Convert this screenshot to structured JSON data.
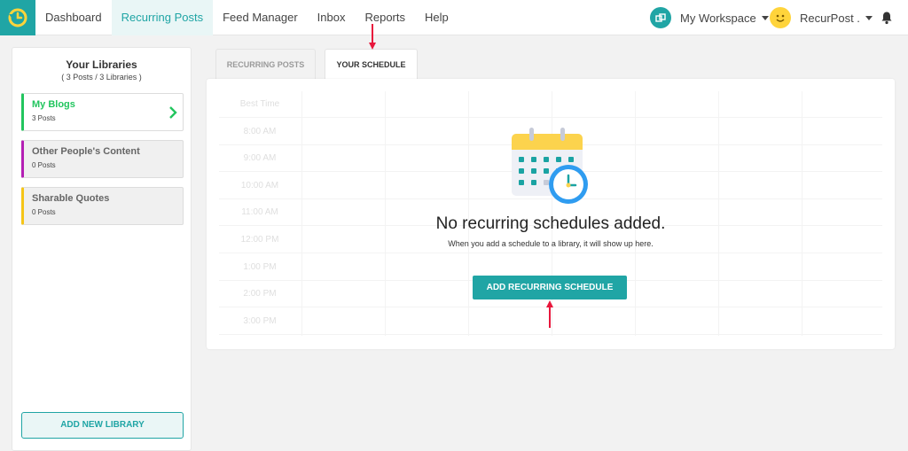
{
  "nav": {
    "items": [
      {
        "label": "Dashboard"
      },
      {
        "label": "Recurring Posts"
      },
      {
        "label": "Feed Manager"
      },
      {
        "label": "Inbox"
      },
      {
        "label": "Reports"
      },
      {
        "label": "Help"
      }
    ],
    "active": "Recurring Posts",
    "workspace": "My Workspace",
    "user": "RecurPost ."
  },
  "sidebar": {
    "title": "Your Libraries",
    "subtitle": "( 3 Posts / 3 Libraries )",
    "libraries": [
      {
        "name": "My Blogs",
        "count": "3 Posts",
        "color": "#22c55e"
      },
      {
        "name": "Other People's Content",
        "count": "0 Posts",
        "color": "#b41fb4"
      },
      {
        "name": "Sharable Quotes",
        "count": "0 Posts",
        "color": "#f5c518"
      }
    ],
    "add_button": "ADD NEW LIBRARY"
  },
  "tabs": [
    {
      "label": "RECURRING POSTS"
    },
    {
      "label": "YOUR SCHEDULE"
    }
  ],
  "schedule": {
    "grid_header": "Best Time",
    "grid_times": [
      "8:00 AM",
      "9:00 AM",
      "10:00 AM",
      "11:00 AM",
      "12:00 PM",
      "1:00 PM",
      "2:00 PM",
      "3:00 PM"
    ],
    "empty_title": "No recurring schedules added.",
    "empty_subtitle": "When you add a schedule to a library, it will show up here.",
    "add_button": "ADD RECURRING SCHEDULE"
  },
  "colors": {
    "accent": "#20a5a5",
    "annotation_arrow": "#e8173c"
  }
}
